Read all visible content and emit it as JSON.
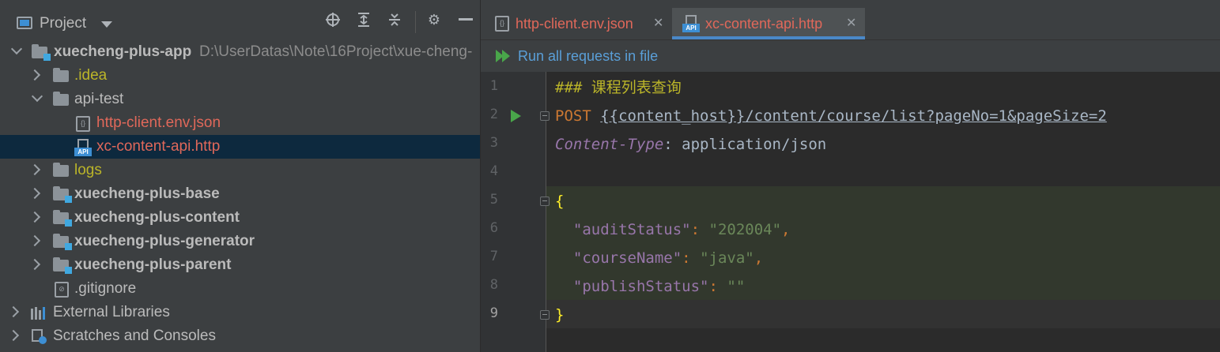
{
  "project_panel": {
    "title": "Project",
    "tree": [
      {
        "label": "xuecheng-plus-app",
        "path": "D:\\UserDatas\\Note\\16Project\\xue-cheng-"
      },
      {
        "label": ".idea"
      },
      {
        "label": "api-test"
      },
      {
        "label": "http-client.env.json"
      },
      {
        "label": "xc-content-api.http"
      },
      {
        "label": "logs"
      },
      {
        "label": "xuecheng-plus-base"
      },
      {
        "label": "xuecheng-plus-content"
      },
      {
        "label": "xuecheng-plus-generator"
      },
      {
        "label": "xuecheng-plus-parent"
      },
      {
        "label": ".gitignore"
      },
      {
        "label": "External Libraries"
      },
      {
        "label": "Scratches and Consoles"
      }
    ]
  },
  "editor": {
    "tabs": [
      {
        "label": "http-client.env.json",
        "active": false
      },
      {
        "label": "xc-content-api.http",
        "active": true
      }
    ],
    "run_all_label": "Run all requests in file",
    "line_numbers": [
      "1",
      "2",
      "3",
      "4",
      "5",
      "6",
      "7",
      "8",
      "9"
    ],
    "code": {
      "l1": "### 课程列表查询",
      "l2_method": "POST",
      "l2_url": "{{content_host}}/content/course/list?pageNo=1&pageSize=2",
      "l3_header": "Content-Type",
      "l3_colon": ": ",
      "l3_value": "application/json",
      "l5": "{",
      "l6_key": "\"auditStatus\"",
      "l6_val": "\"202004\"",
      "l7_key": "\"courseName\"",
      "l7_val": "\"java\"",
      "l8_key": "\"publishStatus\"",
      "l8_val": "\"\"",
      "l9": "}",
      "colon": ": ",
      "comma": ","
    }
  },
  "colors": {
    "accent": "#4a88c7",
    "modified_file": "#e0685a",
    "excluded_folder": "#bbb529",
    "run_green": "#49a64a"
  }
}
